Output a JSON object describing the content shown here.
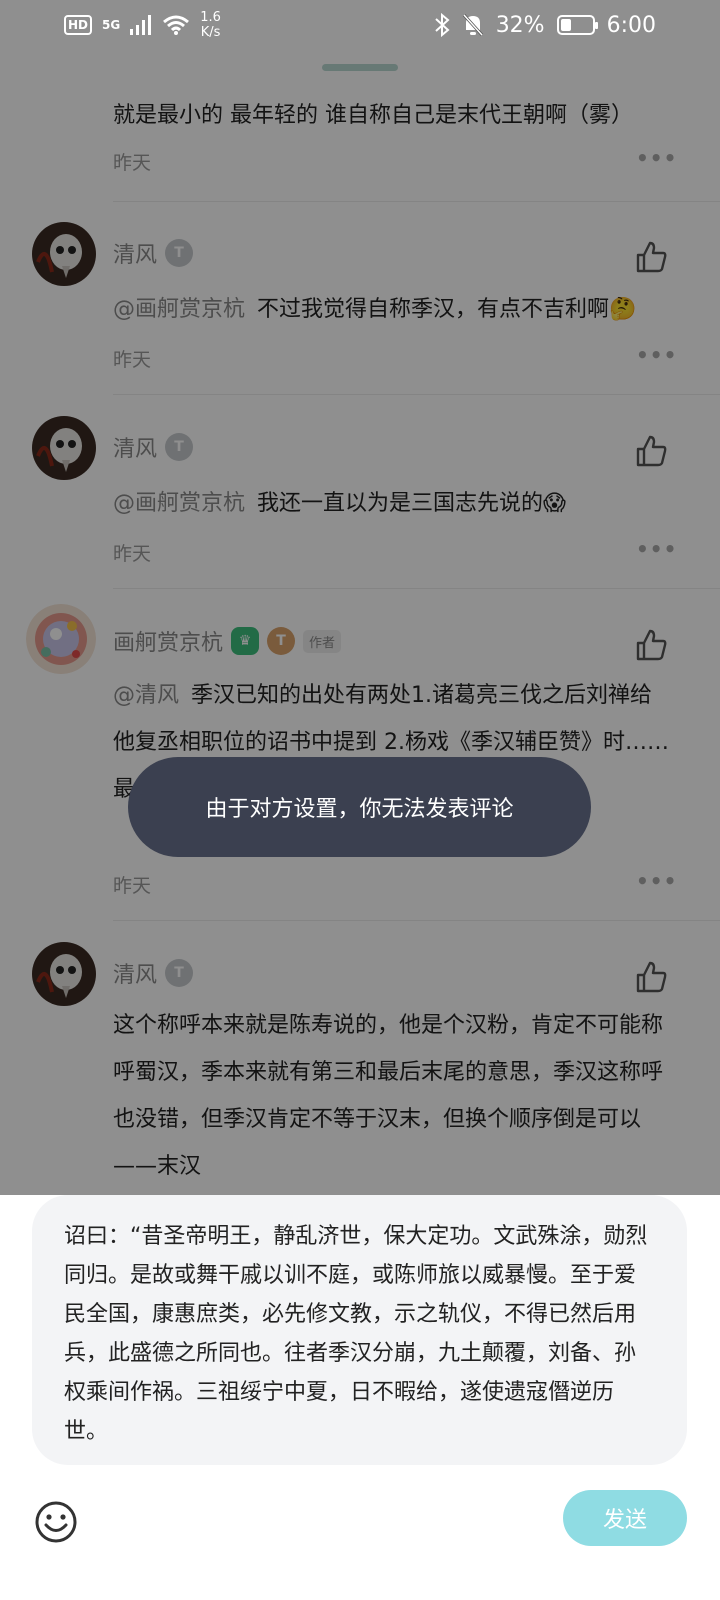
{
  "status_bar": {
    "hd": "HD",
    "net_gen": "5G",
    "net_speed_1": "1.6",
    "net_speed_2": "K/s",
    "battery": "32%",
    "battery_level": 0.32,
    "time": "6:00"
  },
  "comments": [
    {
      "text": "就是最小的 最年轻的 谁自称自己是末代王朝啊（雾）",
      "time": "昨天"
    },
    {
      "name": "清风",
      "level": "T",
      "mention": "@画舸赏京杭",
      "text": "不过我觉得自称季汉，有点不吉利啊🤔",
      "time": "昨天"
    },
    {
      "name": "清风",
      "level": "T",
      "mention": "@画舸赏京杭",
      "text": "我还一直以为是三国志先说的😱",
      "time": "昨天"
    },
    {
      "name": "画舸赏京杭",
      "crown": "♛",
      "level": "T",
      "author_tag": "作者",
      "mention": "@清风",
      "text": "季汉已知的出处有两处1.诸葛亮三伐之后刘禅给他复丞相职位的诏书中提到 2.杨戏《季汉辅臣赞》时……最小的汉……",
      "time": "昨天"
    },
    {
      "name": "清风",
      "level": "T",
      "text": "这个称呼本来就是陈寿说的，他是个汉粉，肯定不可能称呼蜀汉，季本来就有第三和最后末尾的意思，季汉这称呼也没错，但季汉肯定不等于汉末，但换个顺序倒是可以——末汉"
    }
  ],
  "toast": "由于对方设置，你无法发表评论",
  "composer": {
    "text": "诏曰：“昔圣帝明王，静乱济世，保大定功。文武殊涂，勋烈同归。是故或舞干戚以训不庭，或陈师旅以威暴慢。至于爱民全国，康惠庶类，必先修文教，示之轨仪，不得已然后用兵，此盛德之所同也。往者季汉分崩，九土颠覆，刘备、孙权乘间作祸。三祖绥宁中夏，日不暇给，遂使遗寇僭逆历世。",
    "send_label": "发送",
    "emoji_icon": "smiley-icon"
  },
  "colors": {
    "accent": "#8fdce3",
    "toast_bg": "#3b4050",
    "crown_green": "#3dbf7e"
  }
}
